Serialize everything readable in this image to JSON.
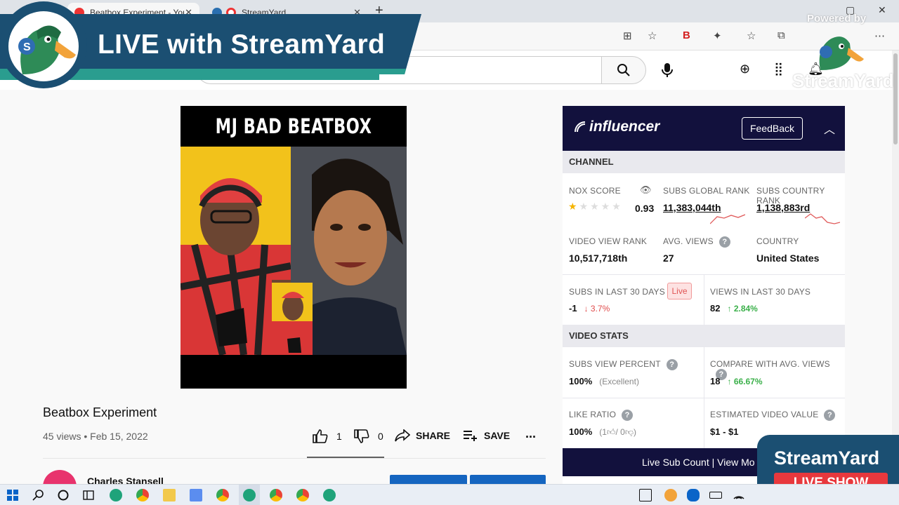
{
  "browser": {
    "tabs": [
      {
        "title": "Beatbox Experiment - YouTube",
        "active": true
      },
      {
        "title": "StreamYard",
        "active": false
      }
    ]
  },
  "streamyard": {
    "banner_title": "LIVE with StreamYard",
    "powered_by": "Powered by",
    "watermark": "StreamYard",
    "corner_brand": "StreamYard",
    "corner_badge": "LIVE SHOW"
  },
  "video": {
    "thumbnail_title": "MJ BAD BEATBOX",
    "title": "Beatbox Experiment",
    "views": "45 views",
    "date": "Feb 15, 2022",
    "likes": "1",
    "dislikes": "0",
    "share_label": "SHARE",
    "save_label": "SAVE",
    "more_label": "...",
    "channel_name": "Charles Stansell"
  },
  "influencer": {
    "logo": "influencer",
    "feedback_label": "FeedBack",
    "channel_section": "CHANNEL",
    "nox_score_label": "NOX SCORE",
    "nox_score_value": "0.93",
    "nox_stars": 0.5,
    "subs_global_rank_label": "SUBS GLOBAL RANK",
    "subs_global_rank_value": "11,383,044th",
    "subs_country_rank_label": "SUBS COUNTRY RANK",
    "subs_country_rank_value": "1,138,883rd",
    "video_view_rank_label": "VIDEO VIEW RANK",
    "video_view_rank_value": "10,517,718th",
    "avg_views_label": "AVG. VIEWS",
    "avg_views_value": "27",
    "country_label": "COUNTRY",
    "country_value": "United States",
    "subs_30_label": "SUBS IN LAST 30 DAYS",
    "live_badge": "Live",
    "subs_30_value": "-1",
    "subs_30_change": "3.7%",
    "views_30_label": "VIEWS IN LAST 30 DAYS",
    "views_30_value": "82",
    "views_30_change": "2.84%",
    "video_stats_section": "VIDEO STATS",
    "subs_view_percent_label": "SUBS VIEW PERCENT",
    "subs_view_percent_value": "100%",
    "subs_view_percent_note": "(Excellent)",
    "compare_label": "COMPARE WITH AVG. VIEWS",
    "compare_value": "18",
    "compare_change": "66.67%",
    "like_ratio_label": "LIKE RATIO",
    "like_ratio_value": "100%",
    "like_ratio_detail_open": "(1",
    "like_ratio_detail_mid": "/ 0",
    "like_ratio_detail_close": ")",
    "est_value_label": "ESTIMATED VIDEO VALUE",
    "est_value_value": "$1 - $1",
    "live_sub_count": "Live Sub Count  |  View Mo"
  },
  "colors": {
    "influencer_navy": "#12113d",
    "streamyard_blue": "#1b4f72",
    "streamyard_teal": "#2a9d8f",
    "live_red": "#e8383d",
    "up_green": "#3bb04a",
    "down_red": "#e04b4b"
  }
}
